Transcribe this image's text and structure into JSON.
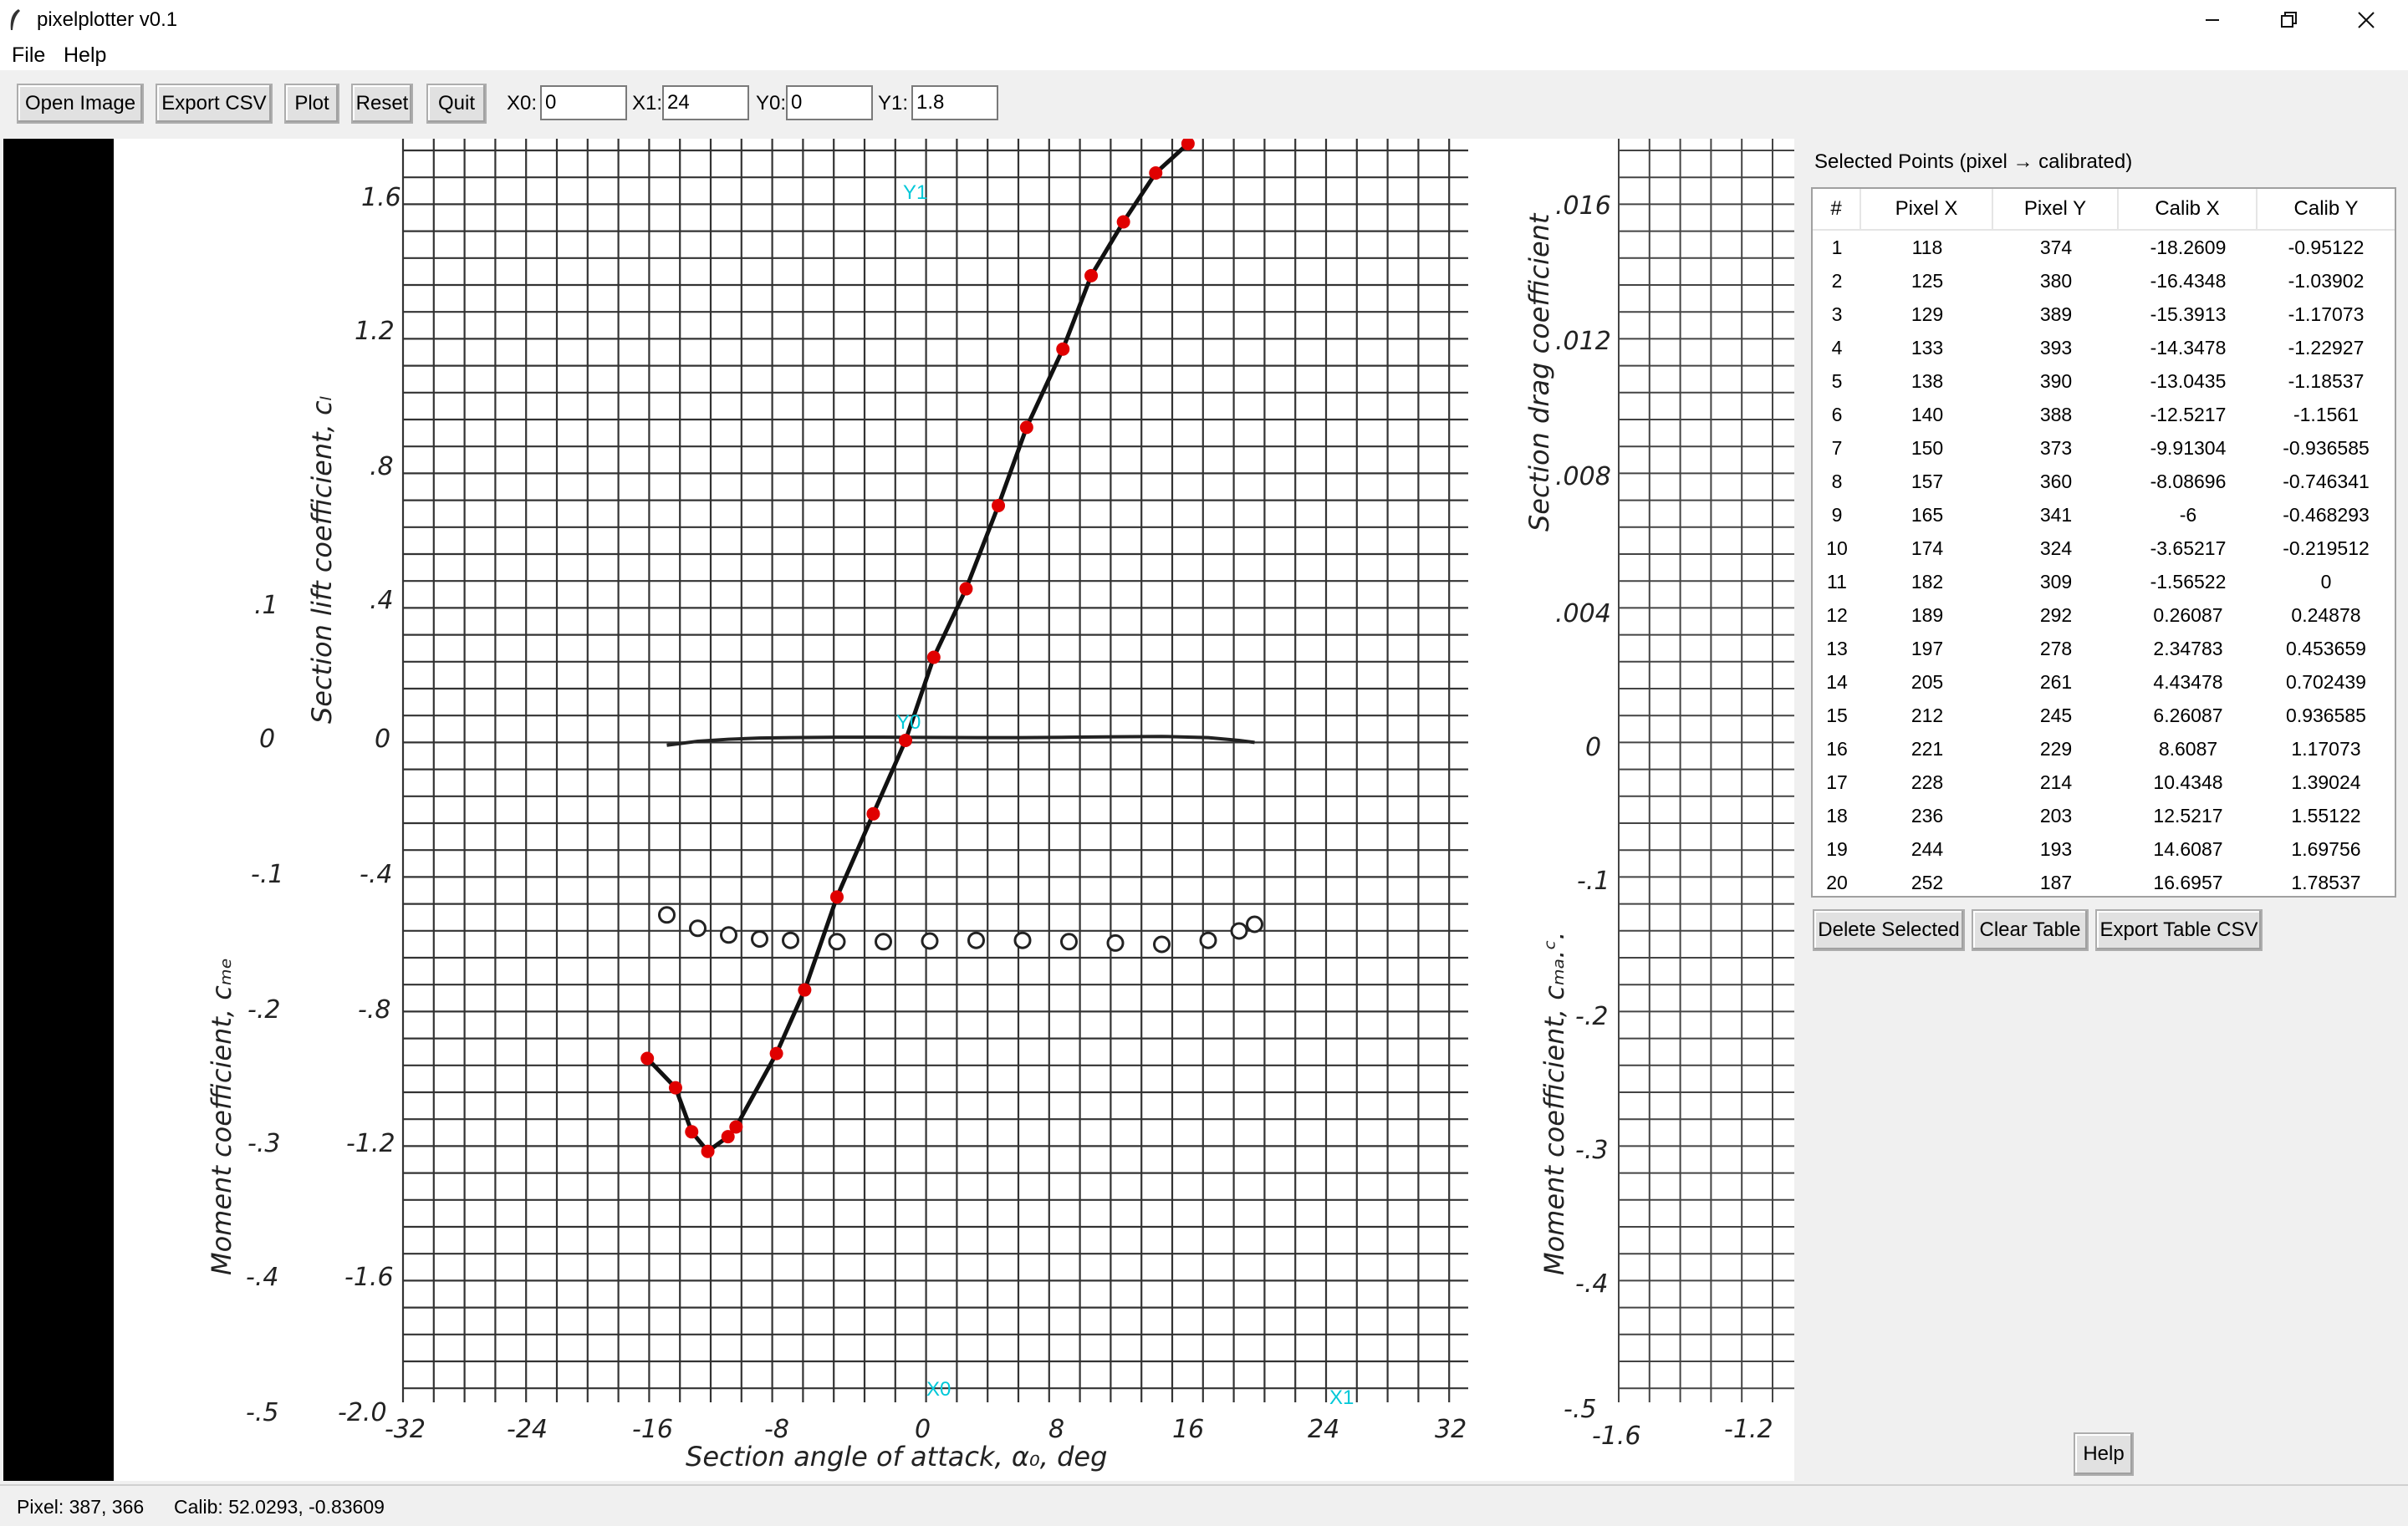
{
  "window": {
    "title": "pixelplotter v0.1",
    "controls": [
      "minimize",
      "restore",
      "close"
    ]
  },
  "menu": [
    "File",
    "Help"
  ],
  "toolbar": {
    "buttons": [
      "Open Image",
      "Export CSV",
      "Plot",
      "Reset",
      "Quit"
    ],
    "fields": [
      {
        "label": "X0:",
        "value": "0"
      },
      {
        "label": "X1:",
        "value": "24"
      },
      {
        "label": "Y0:",
        "value": "0"
      },
      {
        "label": "Y1:",
        "value": "1.8"
      }
    ]
  },
  "image": {
    "left_axis_labels": [
      "1.6",
      "1.2",
      ".8",
      ".4",
      "0",
      "-.4",
      "-.8",
      "-1.2",
      "-1.6",
      "-2.0"
    ],
    "moment_labels": [
      ".1",
      "0",
      "-.1",
      "-.2",
      "-.3",
      "-.4",
      "-.5"
    ],
    "x_labels": [
      "-32",
      "-24",
      "-16",
      "-8",
      "0",
      "8",
      "16",
      "24",
      "32"
    ],
    "right_axis_labels": [
      ".016",
      ".012",
      ".008",
      ".004",
      "0"
    ],
    "right_moment_labels": [
      "-.1",
      "-.2",
      "-.3",
      "-.4",
      "-.5"
    ],
    "right_x_labels": [
      "-1.6",
      "-1.2"
    ],
    "ylabel_lift": "Section lift coefficient, cₗ",
    "ylabel_moment": "Moment coefficient, cₘₑ",
    "xlabel": "Section angle of attack, α₀, deg",
    "ylabel_drag": "Section drag coefficient",
    "ylabel_moment_right": "Moment coefficient, cₘₐ.ᶜ.",
    "markers": {
      "x0": "X0",
      "x1": "X1",
      "y0": "Y0",
      "y1": "Y1"
    },
    "marker_color": "#00c8d8",
    "point_color": "#e00000"
  },
  "panel": {
    "title": "Selected Points (pixel → calibrated)",
    "columns": [
      "#",
      "Pixel X",
      "Pixel Y",
      "Calib X",
      "Calib Y"
    ],
    "rows": [
      [
        "1",
        "118",
        "374",
        "-18.2609",
        "-0.95122"
      ],
      [
        "2",
        "125",
        "380",
        "-16.4348",
        "-1.03902"
      ],
      [
        "3",
        "129",
        "389",
        "-15.3913",
        "-1.17073"
      ],
      [
        "4",
        "133",
        "393",
        "-14.3478",
        "-1.22927"
      ],
      [
        "5",
        "138",
        "390",
        "-13.0435",
        "-1.18537"
      ],
      [
        "6",
        "140",
        "388",
        "-12.5217",
        "-1.1561"
      ],
      [
        "7",
        "150",
        "373",
        "-9.91304",
        "-0.936585"
      ],
      [
        "8",
        "157",
        "360",
        "-8.08696",
        "-0.746341"
      ],
      [
        "9",
        "165",
        "341",
        "-6",
        "-0.468293"
      ],
      [
        "10",
        "174",
        "324",
        "-3.65217",
        "-0.219512"
      ],
      [
        "11",
        "182",
        "309",
        "-1.56522",
        "0"
      ],
      [
        "12",
        "189",
        "292",
        "0.26087",
        "0.24878"
      ],
      [
        "13",
        "197",
        "278",
        "2.34783",
        "0.453659"
      ],
      [
        "14",
        "205",
        "261",
        "4.43478",
        "0.702439"
      ],
      [
        "15",
        "212",
        "245",
        "6.26087",
        "0.936585"
      ],
      [
        "16",
        "221",
        "229",
        "8.6087",
        "1.17073"
      ],
      [
        "17",
        "228",
        "214",
        "10.4348",
        "1.39024"
      ],
      [
        "18",
        "236",
        "203",
        "12.5217",
        "1.55122"
      ],
      [
        "19",
        "244",
        "193",
        "14.6087",
        "1.69756"
      ],
      [
        "20",
        "252",
        "187",
        "16.6957",
        "1.78537"
      ]
    ],
    "buttons": [
      "Delete Selected",
      "Clear Table",
      "Export Table CSV"
    ],
    "help": "Help"
  },
  "status": {
    "pixel": "Pixel: 387, 366",
    "calib": "Calib: 52.0293, -0.83609"
  }
}
